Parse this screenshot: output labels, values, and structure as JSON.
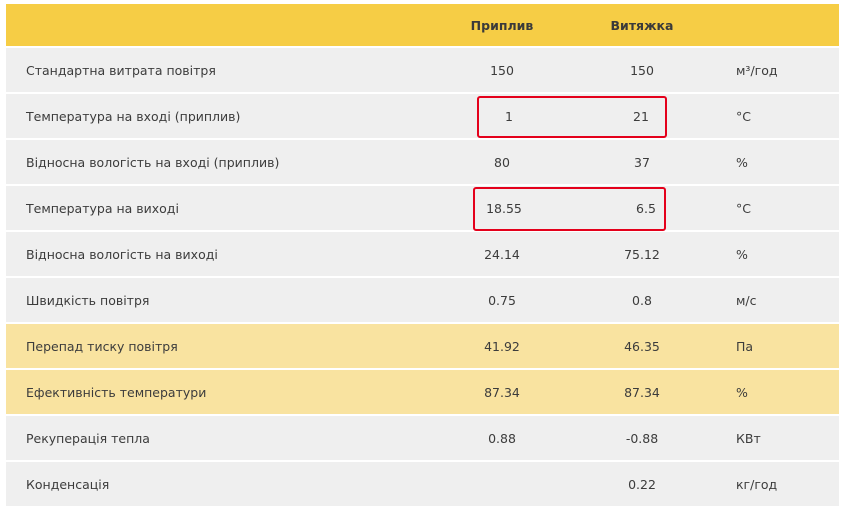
{
  "header": {
    "supply": "Приплив",
    "exhaust": "Витяжка"
  },
  "rows": [
    {
      "label": "Стандартна витрата повітря",
      "supply": "150",
      "exhaust": "150",
      "unit": "м³/год"
    },
    {
      "label": "Температура на вході (приплив)",
      "supply": "1",
      "exhaust": "21",
      "unit": "°C"
    },
    {
      "label": "Відносна вологість на вході (приплив)",
      "supply": "80",
      "exhaust": "37",
      "unit": "%"
    },
    {
      "label": "Температура на виході",
      "supply": "18.55",
      "exhaust": "6.5",
      "unit": "°C"
    },
    {
      "label": "Відносна вологість на виході",
      "supply": "24.14",
      "exhaust": "75.12",
      "unit": "%"
    },
    {
      "label": "Швидкість повітря",
      "supply": "0.75",
      "exhaust": "0.8",
      "unit": "м/с"
    },
    {
      "label": "Перепад тиску повітря",
      "supply": "41.92",
      "exhaust": "46.35",
      "unit": "Па"
    },
    {
      "label": "Ефективність температури",
      "supply": "87.34",
      "exhaust": "87.34",
      "unit": "%"
    },
    {
      "label": "Рекуперація тепла",
      "supply": "0.88",
      "exhaust": "-0.88",
      "unit": "КВт"
    },
    {
      "label": "Конденсація",
      "supply": "",
      "exhaust": "0.22",
      "unit": "кг/год"
    }
  ],
  "colors": {
    "header": "#f6cd45",
    "row": "#efefef",
    "highlight_row": "#f9e3a0",
    "box": "#e4001b"
  }
}
